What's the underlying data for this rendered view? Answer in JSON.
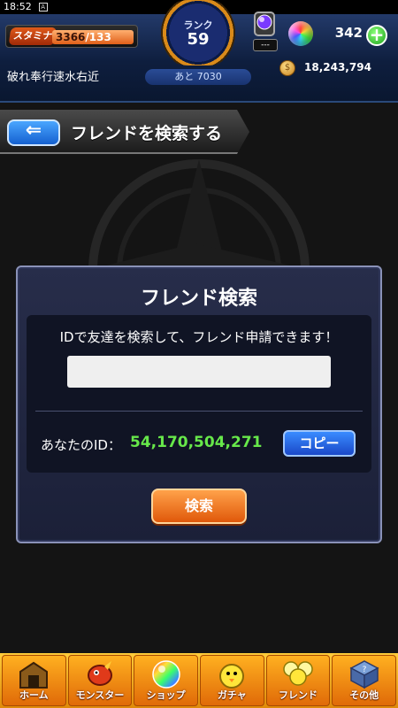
{
  "statusbar": {
    "time": "18:52",
    "notif_icon": "A"
  },
  "header": {
    "stamina_label": "スタミナ",
    "stamina_current": "3366",
    "stamina_max": "/133",
    "stamina_fill_fraction": 1.0,
    "rank_label": "ランク",
    "rank_value": "59",
    "next_label": "あと 7030",
    "strike_text": "---",
    "orb_count": "342",
    "player_name": "破れ奉行速水右近",
    "coin_count": "18,243,794"
  },
  "title": {
    "text": "フレンドを検索する",
    "back_glyph": "⇐"
  },
  "dialog": {
    "title": "フレンド検索",
    "description": "IDで友達を検索して、フレンド申請できます！",
    "input_value": "",
    "id_label": "あなたのID：",
    "id_value": "54,170,504,271",
    "copy_label": "コピー",
    "search_label": "検索"
  },
  "tabs": [
    {
      "label": "ホーム",
      "icon": "home-gate-icon"
    },
    {
      "label": "モンスター",
      "icon": "dragon-icon"
    },
    {
      "label": "ショップ",
      "icon": "rainbow-orb-icon"
    },
    {
      "label": "ガチャ",
      "icon": "chick-icon"
    },
    {
      "label": "フレンド",
      "icon": "balloons-icon"
    },
    {
      "label": "その他",
      "icon": "question-box-icon"
    }
  ],
  "colors": {
    "id_green": "#67e84a",
    "accent_orange": "#e0580a",
    "accent_blue": "#1a48c8"
  }
}
